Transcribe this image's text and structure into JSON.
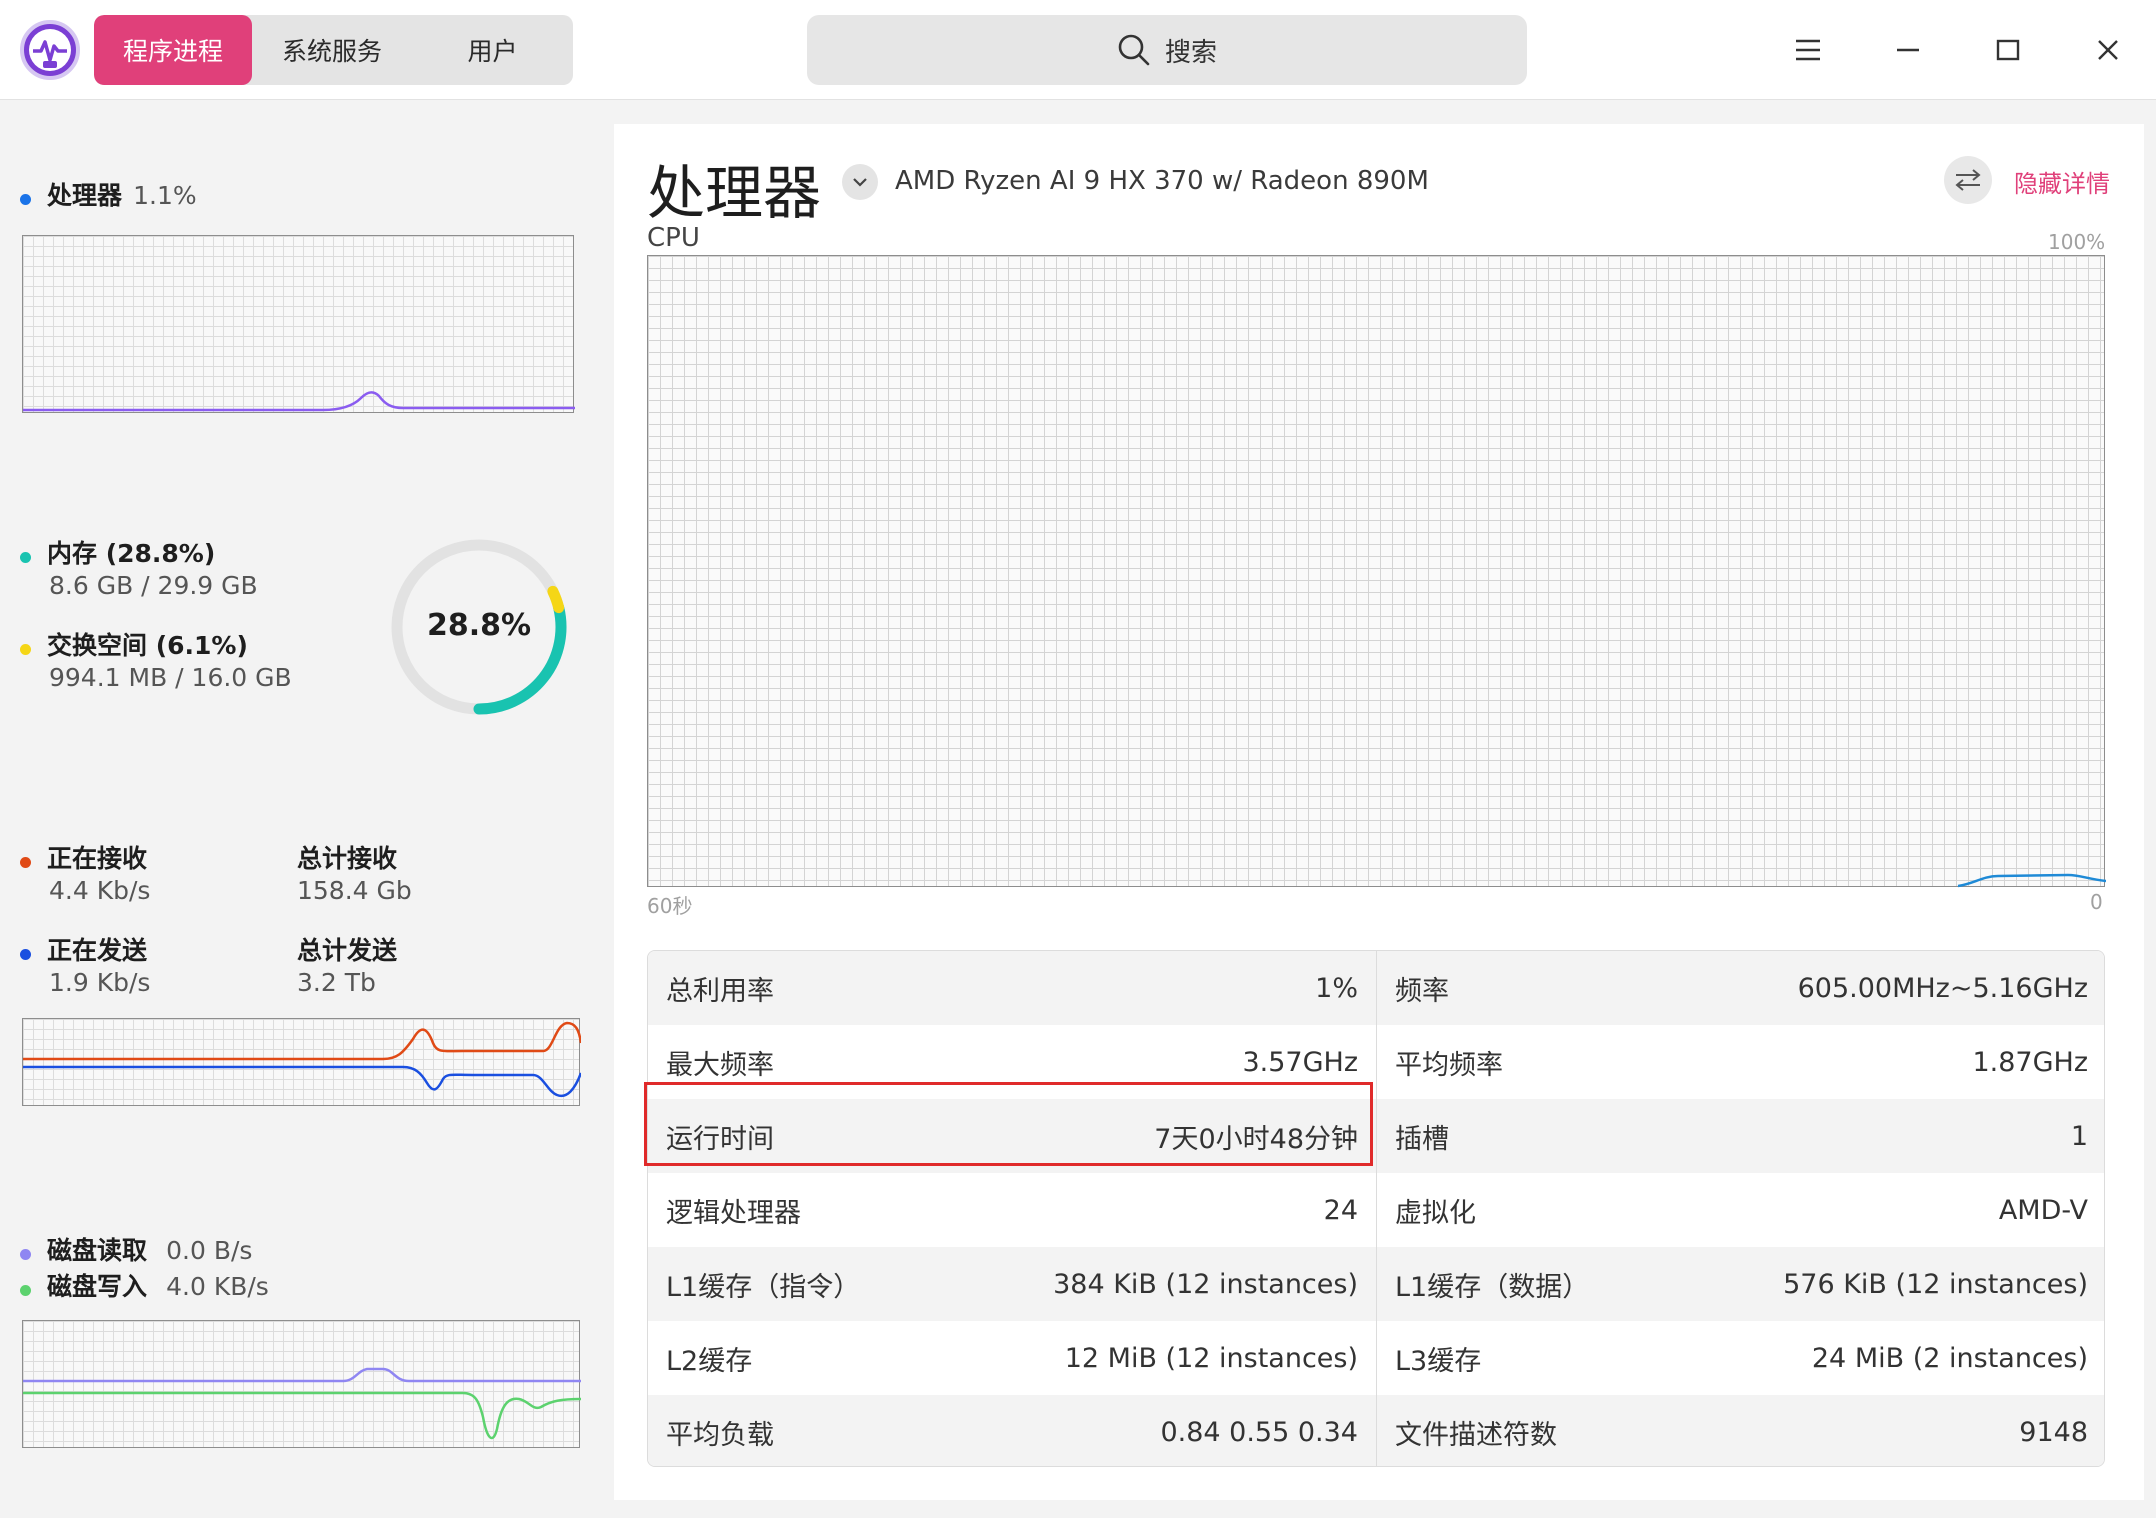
{
  "window": {
    "tabs": [
      {
        "label": "程序进程",
        "active": true
      },
      {
        "label": "系统服务",
        "active": false
      },
      {
        "label": "用户",
        "active": false
      }
    ],
    "search_placeholder": "搜索",
    "accent_color": "#e0407a"
  },
  "sidebar": {
    "cpu": {
      "label": "处理器",
      "value": "1.1%",
      "dot_color": "#1a73e8",
      "series_color": "#8a5cf0"
    },
    "memory": {
      "label": "内存 (28.8%)",
      "detail": "8.6 GB / 29.9 GB",
      "dot_color": "#19c3b0",
      "swap_label": "交换空间 (6.1%)",
      "swap_detail": "994.1 MB / 16.0 GB",
      "swap_dot_color": "#f5d616",
      "ring_text": "28.8%",
      "memory_fraction": 0.288,
      "swap_fraction": 0.061
    },
    "network": {
      "recv_label": "正在接收",
      "recv_value": "4.4 Kb/s",
      "recv_dot_color": "#e04a16",
      "total_recv_label": "总计接收",
      "total_recv_value": "158.4 Gb",
      "send_label": "正在发送",
      "send_value": "1.9 Kb/s",
      "send_dot_color": "#1a4fe0",
      "total_send_label": "总计发送",
      "total_send_value": "3.2 Tb"
    },
    "disk": {
      "read_label": "磁盘读取",
      "read_value": "0.0 B/s",
      "read_dot_color": "#8f86f2",
      "write_label": "磁盘写入",
      "write_value": "4.0 KB/s",
      "write_dot_color": "#5cd26e"
    }
  },
  "main": {
    "title": "处理器",
    "cpu_model": "AMD Ryzen AI 9 HX 370 w/ Radeon 890M",
    "hide_details": "隐藏详情",
    "graph_label": "CPU",
    "graph_max": "100%",
    "graph_left": "60秒",
    "graph_right": "0",
    "rows": [
      {
        "l_label": "总利用率",
        "l_value": "1%",
        "r_label": "频率",
        "r_value": "605.00MHz~5.16GHz"
      },
      {
        "l_label": "最大频率",
        "l_value": "3.57GHz",
        "r_label": "平均频率",
        "r_value": "1.87GHz"
      },
      {
        "l_label": "运行时间",
        "l_value": "7天0小时48分钟",
        "r_label": "插槽",
        "r_value": "1"
      },
      {
        "l_label": "逻辑处理器",
        "l_value": "24",
        "r_label": "虚拟化",
        "r_value": "AMD-V"
      },
      {
        "l_label": "L1缓存（指令）",
        "l_value": "384 KiB (12 instances)",
        "r_label": "L1缓存（数据）",
        "r_value": "576 KiB (12 instances)"
      },
      {
        "l_label": "L2缓存",
        "l_value": "12 MiB (12 instances)",
        "r_label": "L3缓存",
        "r_value": "24 MiB (2 instances)"
      },
      {
        "l_label": "平均负载",
        "l_value": "0.84 0.55 0.34",
        "r_label": "文件描述符数",
        "r_value": "9148"
      }
    ]
  }
}
